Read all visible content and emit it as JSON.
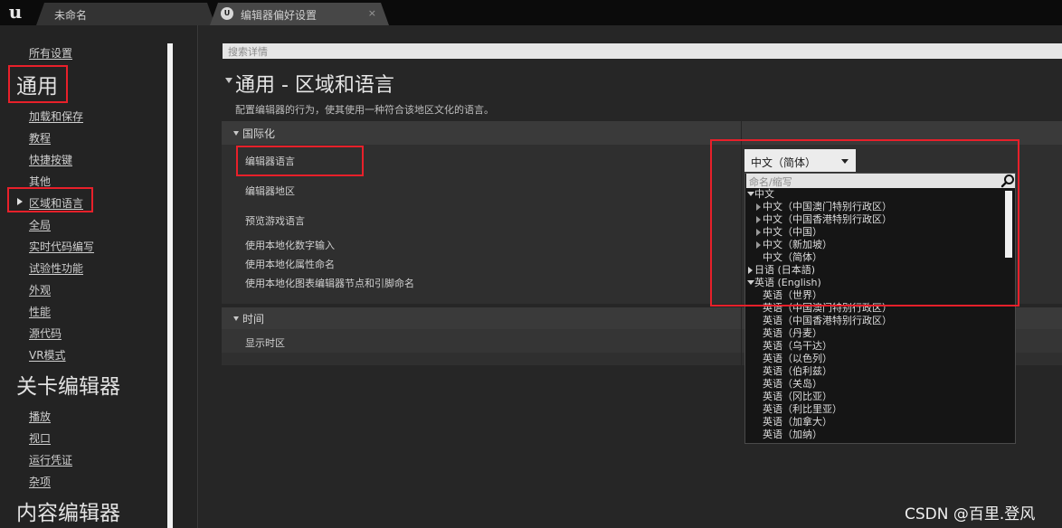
{
  "tabs": [
    {
      "label": "未命名"
    },
    {
      "label": "编辑器偏好设置",
      "icon": "unreal-icon",
      "close": "×"
    }
  ],
  "sidebar": {
    "all_settings": "所有设置",
    "section_general": "通用",
    "general_items": [
      "加载和保存",
      "教程",
      "快捷按键",
      "其他",
      "区域和语言",
      "全局",
      "实时代码编写",
      "试验性功能",
      "外观",
      "性能",
      "源代码",
      "VR模式"
    ],
    "section_level_editor": "关卡编辑器",
    "level_items": [
      "播放",
      "视口",
      "运行凭证",
      "杂项"
    ],
    "section_content_editor": "内容编辑器"
  },
  "search": {
    "placeholder": "搜索详情"
  },
  "main": {
    "title": "通用 - 区域和语言",
    "description": "配置编辑器的行为，使其使用一种符合该地区文化的语言。",
    "categories": [
      {
        "label": "国际化",
        "properties": [
          "编辑器语言",
          "编辑器地区",
          "预览游戏语言",
          "使用本地化数字输入",
          "使用本地化属性命名",
          "使用本地化图表编辑器节点和引脚命名"
        ]
      },
      {
        "label": "时间",
        "properties": [
          "显示时区"
        ]
      }
    ]
  },
  "combo": {
    "value": "中文（简体）"
  },
  "dropdown": {
    "search_placeholder": "命名/缩写",
    "items": [
      {
        "label": "中文",
        "level": 0,
        "expander": "expanded"
      },
      {
        "label": "中文（中国澳门特别行政区）",
        "level": 1,
        "expander": "collapsed"
      },
      {
        "label": "中文（中国香港特别行政区）",
        "level": 1,
        "expander": "collapsed"
      },
      {
        "label": "中文（中国）",
        "level": 1,
        "expander": "collapsed"
      },
      {
        "label": "中文（新加坡）",
        "level": 1,
        "expander": "collapsed"
      },
      {
        "label": "中文（简体）",
        "level": 1,
        "expander": "none"
      },
      {
        "label": "日语 (日本語)",
        "level": 0,
        "expander": "collapsed"
      },
      {
        "label": "英语 (English)",
        "level": 0,
        "expander": "expanded"
      },
      {
        "label": "英语（世界）",
        "level": 1,
        "expander": "none"
      },
      {
        "label": "英语（中国澳门特别行政区）",
        "level": 1,
        "expander": "none"
      },
      {
        "label": "英语（中国香港特别行政区）",
        "level": 1,
        "expander": "none"
      },
      {
        "label": "英语（丹麦）",
        "level": 1,
        "expander": "none"
      },
      {
        "label": "英语（乌干达）",
        "level": 1,
        "expander": "none"
      },
      {
        "label": "英语（以色列）",
        "level": 1,
        "expander": "none"
      },
      {
        "label": "英语（伯利兹）",
        "level": 1,
        "expander": "none"
      },
      {
        "label": "英语（关岛）",
        "level": 1,
        "expander": "none"
      },
      {
        "label": "英语（冈比亚）",
        "level": 1,
        "expander": "none"
      },
      {
        "label": "英语（利比里亚）",
        "level": 1,
        "expander": "none"
      },
      {
        "label": "英语（加拿大）",
        "level": 1,
        "expander": "none"
      },
      {
        "label": "英语（加纳）",
        "level": 1,
        "expander": "none"
      }
    ]
  },
  "watermark": "CSDN @百里.登风",
  "colors": {
    "highlight_box": "#e8202a",
    "background": "#262626"
  }
}
